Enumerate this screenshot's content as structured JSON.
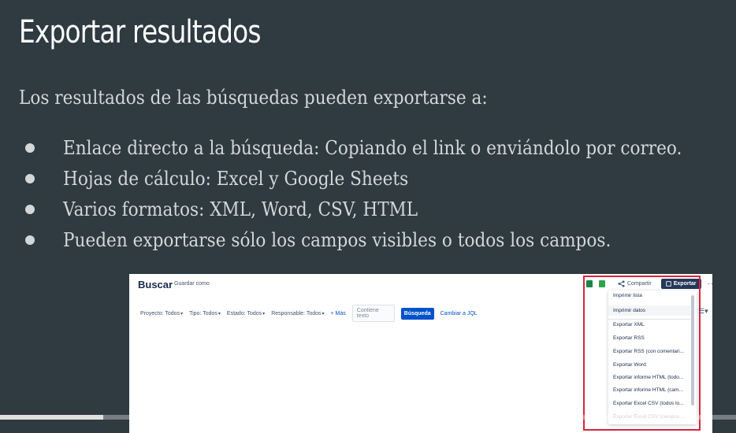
{
  "slide": {
    "title": "Exportar resultados",
    "intro": "Los resultados de las búsquedas pueden exportarse a:",
    "bullets": [
      "Enlace directo a la búsqueda: Copiando el link o enviándolo por correo.",
      "Hojas de cálculo: Excel y Google Sheets",
      "Varios formatos: XML, Word, CSV, HTML",
      "Pueden exportarse sólo los campos visibles o todos los campos."
    ]
  },
  "screenshot": {
    "title": "Buscar",
    "save_as": "Guardar como",
    "filters": {
      "project": "Proyecto: Todos",
      "type": "Tipo: Todos",
      "status": "Estado: Todos",
      "assignee": "Responsable: Todos",
      "more": "+ Más",
      "search_placeholder": "Contiene texto",
      "search_button": "Búsqueda",
      "jql_link": "Cambiar a JQL"
    },
    "toolbar": {
      "share": "Compartir",
      "export": "Exportar",
      "more": "···"
    },
    "export_menu": [
      "Imprimir lista",
      "Imprimir datos",
      "Exportar XML",
      "Exportar RSS",
      "Exportar RSS (con comentari...",
      "Exportar Word",
      "Exportar informe HTML (todo...",
      "Exportar informe HTML (cam...",
      "Exportar Excel CSV (todos lo...",
      "Exportar Excel CSV (campos ..."
    ]
  },
  "icons": {
    "excel": "excel-icon",
    "sheets": "google-sheets-icon",
    "share": "share-icon",
    "list_view": "list-view-icon"
  },
  "colors": {
    "background": "#2f3a41",
    "accent_blue": "#0052cc",
    "highlight_box": "#d7263d"
  },
  "video_progress": 0.14
}
